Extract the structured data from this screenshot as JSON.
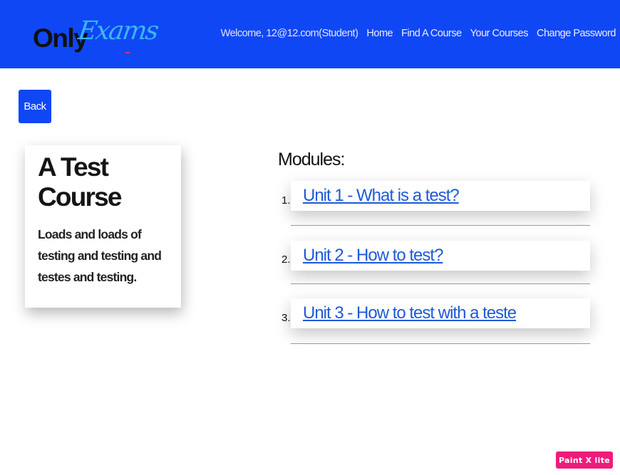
{
  "brand": {
    "part1": "nly",
    "part1_o": "O",
    "part2": "Exams",
    "colors": {
      "part1": "#101010",
      "part2": "#39b6f2",
      "navbar": "#1047f5"
    }
  },
  "nav": {
    "welcome": "Welcome, 12@12.com(Student)",
    "links": [
      "Home",
      "Find A Course",
      "Your Courses",
      "Change Password"
    ]
  },
  "back_label": "Back",
  "course": {
    "title": "A Test Course",
    "description": "Loads and loads of testing and testing and testes and testing."
  },
  "modules": {
    "heading": "Modules:",
    "items": [
      {
        "number": "1.",
        "title": "Unit 1 - What is a test?"
      },
      {
        "number": "2.",
        "title": "Unit 2 - How to test?"
      },
      {
        "number": "3.",
        "title": "Unit 3 - How to test with a teste"
      }
    ]
  },
  "watermark": "Paint X lite",
  "colors": {
    "link": "#1e5ad8",
    "button": "#1047f5",
    "watermark": "#ee1c7a"
  }
}
